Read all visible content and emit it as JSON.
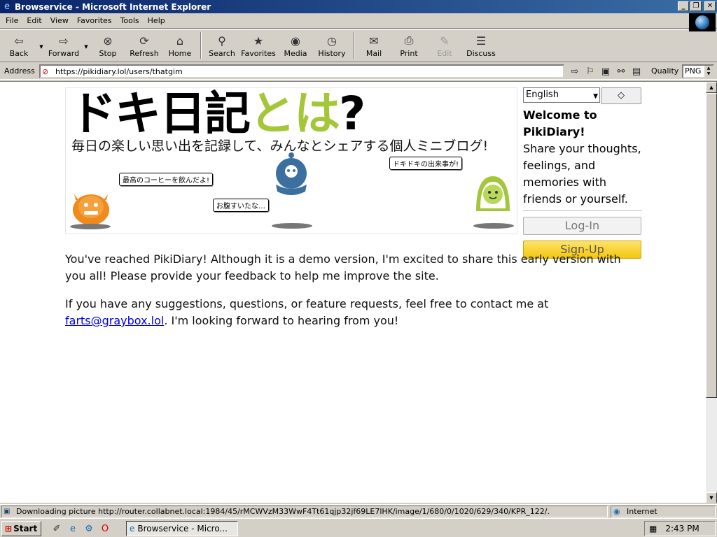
{
  "window": {
    "title": "Browservice - Microsoft Internet Explorer",
    "buttons": {
      "minimize": "_",
      "maximize": "❐",
      "close": "✕"
    }
  },
  "menu": {
    "items": [
      "File",
      "Edit",
      "View",
      "Favorites",
      "Tools",
      "Help"
    ]
  },
  "toolbar": {
    "buttons": [
      {
        "label": "Back",
        "icon": "⇦"
      },
      {
        "label": "Forward",
        "icon": "⇨"
      },
      {
        "label": "Stop",
        "icon": "⊗"
      },
      {
        "label": "Refresh",
        "icon": "⟳"
      },
      {
        "label": "Home",
        "icon": "⌂"
      },
      {
        "label": "Search",
        "icon": "⚲"
      },
      {
        "label": "Favorites",
        "icon": "★"
      },
      {
        "label": "Media",
        "icon": "◉"
      },
      {
        "label": "History",
        "icon": "◷"
      },
      {
        "label": "Mail",
        "icon": "✉"
      },
      {
        "label": "Print",
        "icon": "⎙"
      },
      {
        "label": "Edit",
        "icon": "✎"
      },
      {
        "label": "Discuss",
        "icon": "☰"
      }
    ]
  },
  "address": {
    "label": "Address",
    "url": "https://pikidiary.lol/users/thatgim",
    "quality_label": "Quality",
    "quality_value": "PNG"
  },
  "page": {
    "banner": {
      "logo_part1": "ドキ日記",
      "logo_part2": "とは",
      "logo_part3": "?",
      "tagline": "毎日の楽しい思い出を記録して、みんなとシェアする個人ミニブログ!",
      "bubble1": "最高のコーヒーを飲んだよ!",
      "bubble2": "お腹すいたな…",
      "bubble3": "ドキドキの出来事が!"
    },
    "side": {
      "language": "English",
      "diamond_button": "◇",
      "welcome_title": "Welcome to PikiDiary!",
      "welcome_text": "Share your thoughts, feelings, and memories with friends or yourself.",
      "login": "Log-In",
      "signup": "Sign-Up"
    },
    "para1": "You've reached PikiDiary! Although it is a demo version, I'm excited to share this early version with you all! Please provide your feedback to help me improve the site.",
    "para2_before": "If you have any suggestions, questions, or feature requests, feel free to contact me at ",
    "para2_link": "farts@graybox.lol",
    "para2_after": ". I'm looking forward to hearing from you!"
  },
  "status": {
    "text": "Downloading picture http://router.collabnet.local:1984/45/rMCWVzM33WwF4Tt61qjp32jf69LE7lHK/image/1/680/0/1020/629/340/KPR_122/.",
    "zone": "Internet"
  },
  "taskbar": {
    "start": "Start",
    "task": "Browservice - Micro...",
    "clock": "2:43 PM"
  }
}
